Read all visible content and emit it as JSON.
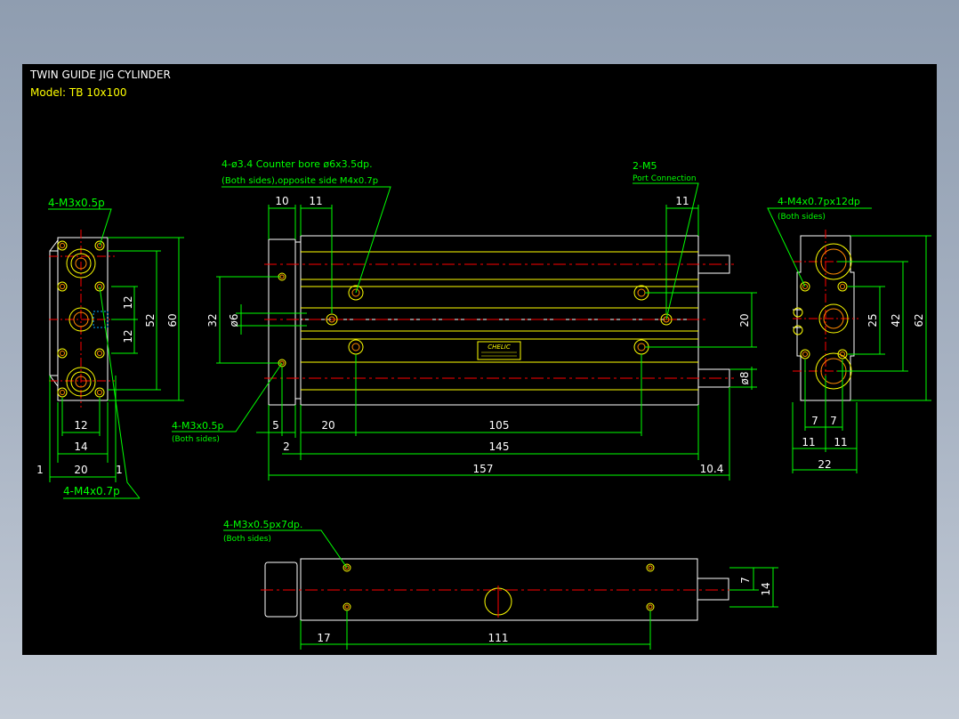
{
  "title": {
    "name": "TWIN GUIDE JIG CYLINDER",
    "model": "Model:  TB  10x100"
  },
  "colors": {
    "background": "#000000",
    "outline": "#ffffff",
    "yellow": "#ffff00",
    "green": "#00ff00",
    "red": "#ff0000",
    "orange": "#ff8800",
    "page": "#a8b3c3"
  },
  "views": {
    "left": {
      "callout_top": "4-M3x0.5p",
      "callout_bottom": "4-M4x0.7p",
      "dims": {
        "d12a": "12",
        "d12b": "12",
        "d52": "52",
        "d60": "60",
        "b12": "12",
        "b14": "14",
        "b20": "20",
        "b1a": "1",
        "b1b": "1"
      }
    },
    "front": {
      "callout_bore": "4-ø3.4  Counter bore  ø6x3.5dp.",
      "callout_bore_sub": "(Both sides),opposite side M4x0.7p",
      "callout_port": "2-M5",
      "callout_port_sub": "Port Connection",
      "callout_side": "4-M3x0.5p",
      "callout_side_sub": "(Both sides)",
      "brand": "CHELIC",
      "dims": {
        "t10": "10",
        "t11a": "11",
        "t11b": "11",
        "l32": "32",
        "lphi6": "ø6",
        "r20": "20",
        "rphi8": "ø8",
        "b5": "5",
        "b20": "20",
        "b105": "105",
        "b2": "2",
        "b145": "145",
        "b157": "157",
        "b104": "10.4"
      }
    },
    "right": {
      "callout": "4-M4x0.7px12dp",
      "callout_sub": "(Both sides)",
      "dims": {
        "r25": "25",
        "r42": "42",
        "r62": "62",
        "b7a": "7",
        "b7b": "7",
        "b11a": "11",
        "b11b": "11",
        "b22": "22"
      }
    },
    "bottom": {
      "callout": "4-M3x0.5px7dp.",
      "callout_sub": "(Both sides)",
      "dims": {
        "b17": "17",
        "b111": "111",
        "r7": "7",
        "r14": "14"
      }
    }
  }
}
